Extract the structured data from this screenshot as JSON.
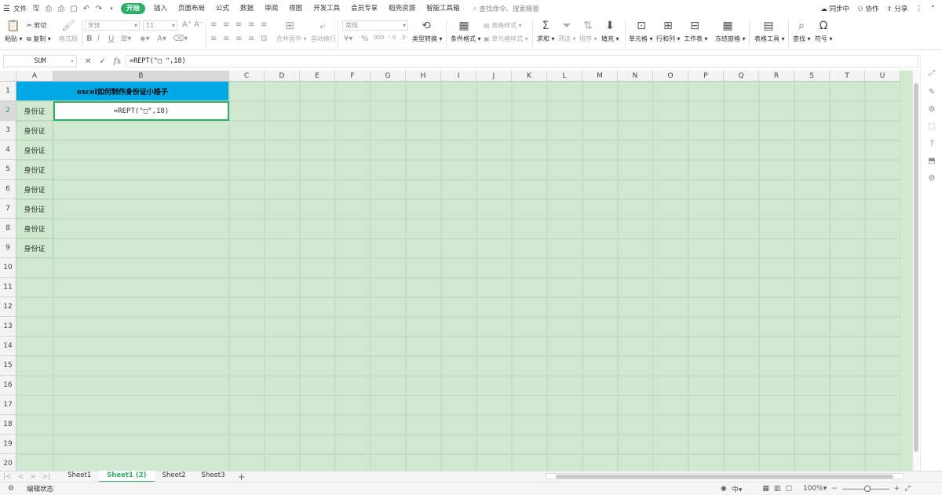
{
  "topbar": {
    "file_menu": "文件",
    "menus": [
      {
        "label": "开始",
        "active": true
      },
      {
        "label": "插入",
        "active": false
      },
      {
        "label": "页面布局",
        "active": false
      },
      {
        "label": "公式",
        "active": false
      },
      {
        "label": "数据",
        "active": false
      },
      {
        "label": "审阅",
        "active": false
      },
      {
        "label": "视图",
        "active": false
      },
      {
        "label": "开发工具",
        "active": false
      },
      {
        "label": "会员专享",
        "active": false
      },
      {
        "label": "稻壳资源",
        "active": false
      },
      {
        "label": "智能工具箱",
        "active": false
      }
    ],
    "search_placeholder": "查找命令、搜索模板",
    "sync": "同步中",
    "collab": "协作",
    "share": "分享"
  },
  "ribbon": {
    "paste": "粘贴",
    "cut": "剪切",
    "copy": "复制",
    "format_painter": "格式刷",
    "font_name": "宋体",
    "font_size": "11",
    "merge_center": "合并居中",
    "wrap_text": "自动换行",
    "number_format": "常规",
    "type_convert": "类型转换",
    "cond_format": "条件格式",
    "table_style": "表格样式",
    "cell_style": "单元格样式",
    "sum": "求和",
    "filter": "筛选",
    "sort": "排序",
    "fill": "填充",
    "cell": "单元格",
    "row_col": "行和列",
    "worksheet": "工作表",
    "freeze": "冻结窗格",
    "table_tools": "表格工具",
    "find": "查找",
    "symbol": "符号"
  },
  "formula_bar": {
    "name_box": "SUM",
    "formula": "=REPT(\"□ \",18)"
  },
  "sheet": {
    "columns": [
      "A",
      "B",
      "C",
      "D",
      "E",
      "F",
      "G",
      "H",
      "I",
      "J",
      "K",
      "L",
      "M",
      "N",
      "O",
      "P",
      "Q",
      "R",
      "S",
      "T",
      "U"
    ],
    "rows": [
      "1",
      "2",
      "3",
      "4",
      "5",
      "6",
      "7",
      "8",
      "9",
      "10",
      "11",
      "12",
      "13",
      "14",
      "15",
      "16",
      "17",
      "18",
      "19",
      "20"
    ],
    "title": "excel如何制作身份证小格子",
    "a_column_values": [
      "身份证",
      "身份证",
      "身份证",
      "身份证",
      "身份证",
      "身份证",
      "身份证",
      "身份证"
    ],
    "active_cell_text": "=REPT(\"□\",18)",
    "active_column": "B",
    "active_row": "2"
  },
  "tabs": {
    "sheets": [
      {
        "label": "Sheet1",
        "active": false
      },
      {
        "label": "Sheet1 (2)",
        "active": true
      },
      {
        "label": "Sheet2",
        "active": false
      },
      {
        "label": "Sheet3",
        "active": false
      }
    ]
  },
  "status": {
    "mode": "编辑状态",
    "zoom": "100%",
    "lang": "中"
  },
  "colors": {
    "accent": "#2bae66",
    "title_fill": "#00a8e6",
    "grid_fill": "#cfe8cf"
  }
}
